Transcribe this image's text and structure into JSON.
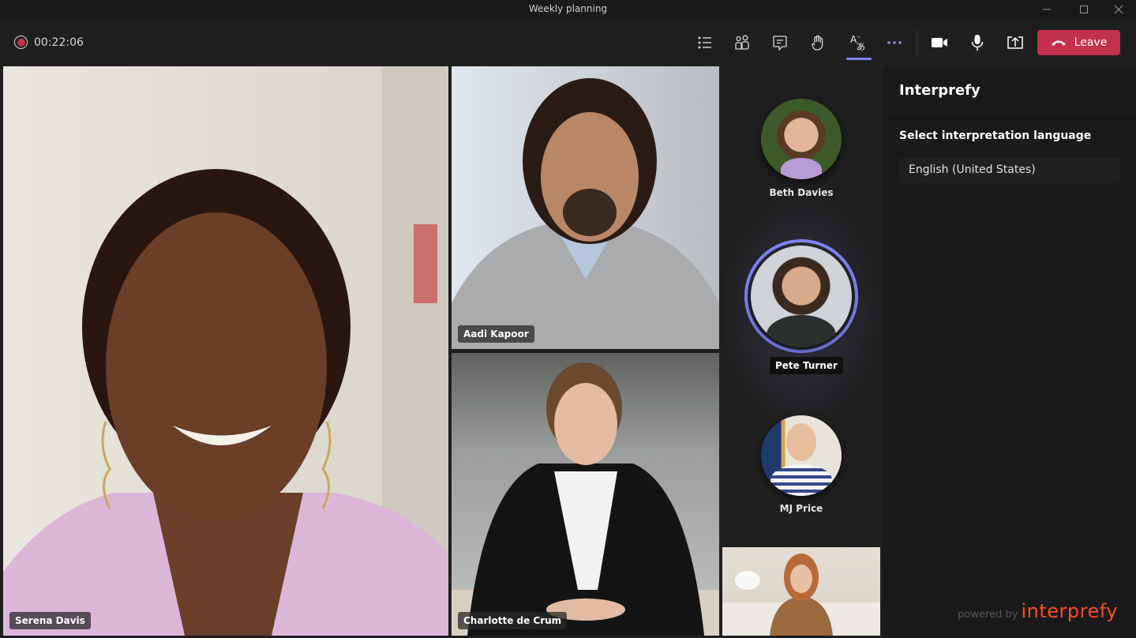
{
  "window": {
    "title": "Weekly planning",
    "controls": [
      "minimize",
      "maximize",
      "close"
    ]
  },
  "toolbar": {
    "recording_time": "00:22:06",
    "buttons": [
      {
        "name": "participants-list",
        "icon": "list-icon"
      },
      {
        "name": "people",
        "icon": "people-icon"
      },
      {
        "name": "chat",
        "icon": "chat-icon"
      },
      {
        "name": "raise-hand",
        "icon": "hand-icon"
      },
      {
        "name": "translate",
        "icon": "translate-icon",
        "active": true
      },
      {
        "name": "more",
        "icon": "more-icon"
      },
      {
        "name": "camera",
        "icon": "camera-icon"
      },
      {
        "name": "mic",
        "icon": "mic-icon"
      },
      {
        "name": "share",
        "icon": "share-icon"
      }
    ],
    "leave_label": "Leave"
  },
  "participants": {
    "main": [
      {
        "name": "Serena Davis"
      },
      {
        "name": "Aadi Kapoor"
      },
      {
        "name": "Charlotte de Crum"
      }
    ],
    "avatars": [
      {
        "name": "Beth Davies"
      },
      {
        "name": "Pete Turner",
        "speaking": true
      },
      {
        "name": "MJ Price"
      }
    ],
    "self_view": {
      "name": ""
    }
  },
  "panel": {
    "title": "Interprefy",
    "label": "Select interpretation language",
    "selected_language": "English (United States)",
    "powered_by": "powered by",
    "brand": "interprefy"
  },
  "colors": {
    "accent": "#7f85f5",
    "leave": "#c4314b",
    "brand": "#ff4c1f"
  }
}
